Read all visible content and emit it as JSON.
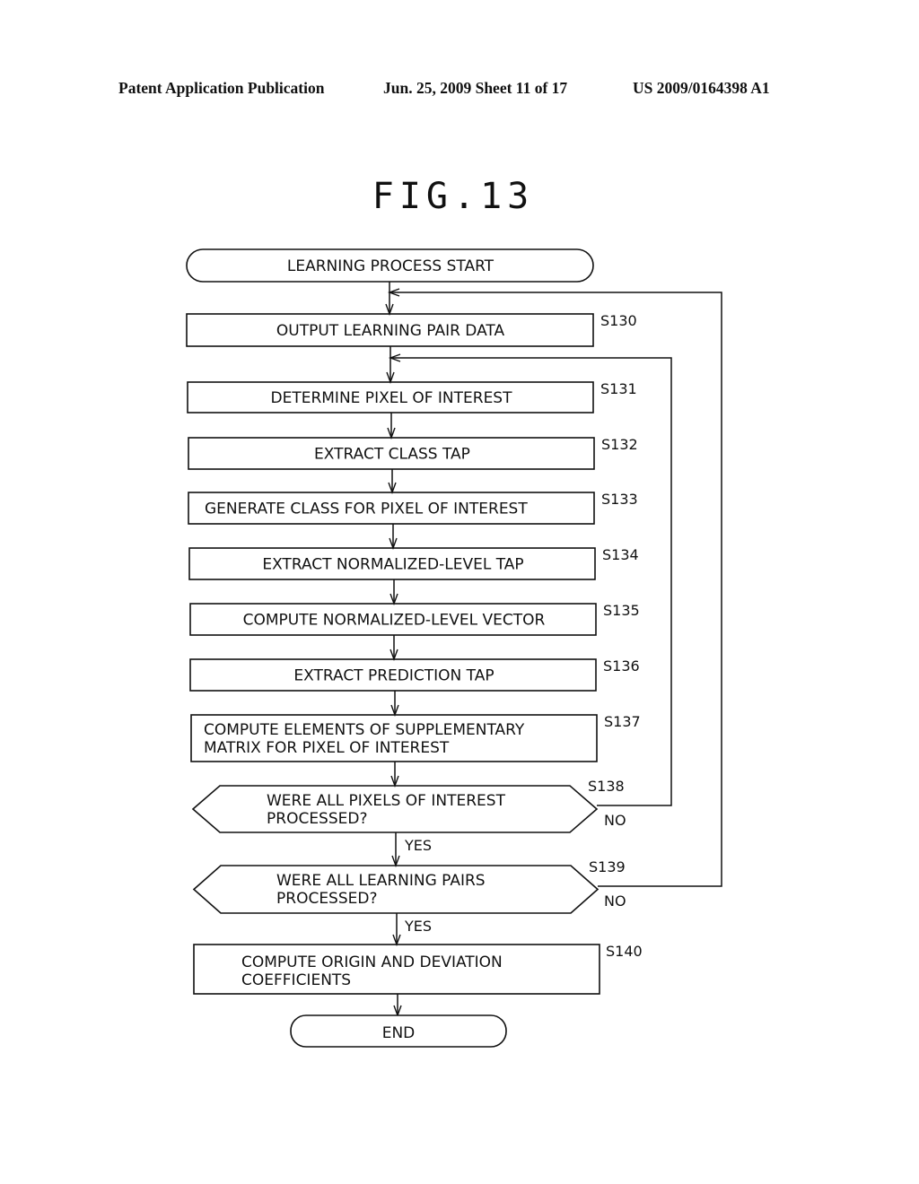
{
  "header": {
    "publication": "Patent Application Publication",
    "date_sheet": "Jun. 25, 2009  Sheet 11 of 17",
    "pub_number": "US 2009/0164398 A1"
  },
  "figure": {
    "title": "FIG.13",
    "start": {
      "label": "LEARNING PROCESS START"
    },
    "end": {
      "label": "END"
    },
    "steps": [
      {
        "id": "S130",
        "lines": [
          "OUTPUT LEARNING PAIR DATA"
        ]
      },
      {
        "id": "S131",
        "lines": [
          "DETERMINE PIXEL OF INTEREST"
        ]
      },
      {
        "id": "S132",
        "lines": [
          "EXTRACT CLASS TAP"
        ]
      },
      {
        "id": "S133",
        "lines": [
          "GENERATE CLASS FOR PIXEL OF INTEREST"
        ]
      },
      {
        "id": "S134",
        "lines": [
          "EXTRACT NORMALIZED-LEVEL TAP"
        ]
      },
      {
        "id": "S135",
        "lines": [
          "COMPUTE NORMALIZED-LEVEL VECTOR"
        ]
      },
      {
        "id": "S136",
        "lines": [
          "EXTRACT PREDICTION TAP"
        ]
      },
      {
        "id": "S137",
        "lines": [
          "COMPUTE ELEMENTS OF SUPPLEMENTARY",
          "MATRIX FOR PIXEL OF INTEREST"
        ]
      }
    ],
    "decisions": [
      {
        "id": "S138",
        "lines": [
          "WERE ALL PIXELS OF INTEREST",
          "PROCESSED?"
        ],
        "yes": "YES",
        "no": "NO",
        "no_target": "S131"
      },
      {
        "id": "S139",
        "lines": [
          "WERE ALL LEARNING PAIRS",
          "PROCESSED?"
        ],
        "yes": "YES",
        "no": "NO",
        "no_target": "S130"
      }
    ],
    "final_step": {
      "id": "S140",
      "lines": [
        "COMPUTE ORIGIN AND DEVIATION",
        "COEFFICIENTS"
      ]
    }
  }
}
